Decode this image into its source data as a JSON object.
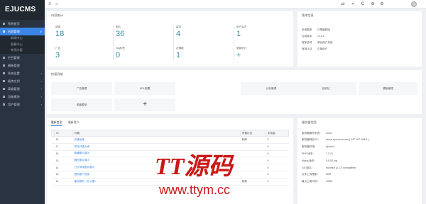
{
  "app": {
    "logo": "EJUCMS"
  },
  "sidebar": {
    "items": [
      {
        "label": "系统首页",
        "active": false,
        "sub": false,
        "chev": ""
      },
      {
        "label": "内容管理",
        "active": true,
        "sub": false,
        "chev": "∨"
      },
      {
        "label": "新闻中心",
        "active": false,
        "sub": true,
        "chev": ""
      },
      {
        "label": "图集中心",
        "active": false,
        "sub": true,
        "chev": ""
      },
      {
        "label": "单页内容",
        "active": false,
        "sub": true,
        "chev": ""
      },
      {
        "label": "栏目管理",
        "active": false,
        "sub": false,
        "chev": ""
      },
      {
        "label": "模板管理",
        "active": false,
        "sub": false,
        "chev": ""
      },
      {
        "label": "系统设置",
        "active": false,
        "sub": false,
        "chev": "›"
      },
      {
        "label": "插件应用",
        "active": false,
        "sub": false,
        "chev": "›"
      },
      {
        "label": "高级管理",
        "active": false,
        "sub": false,
        "chev": "›"
      },
      {
        "label": "功能模块",
        "active": false,
        "sub": false,
        "chev": "›"
      },
      {
        "label": "用户管理",
        "active": false,
        "sub": false,
        "chev": "›"
      }
    ]
  },
  "topbar": {
    "left_icons": [
      "≡",
      "⌂"
    ],
    "right_icons": [
      "⇄",
      "»",
      "C",
      "⊕",
      "⚙"
    ]
  },
  "stats": {
    "title": "内容统计",
    "items": [
      {
        "label": "新闻",
        "value": "18"
      },
      {
        "label": "图片",
        "value": "36"
      },
      {
        "label": "留言",
        "value": "4"
      },
      {
        "label": "用户会员",
        "value": "1"
      },
      {
        "label": "广告",
        "value": "3"
      },
      {
        "label": "Tag标签",
        "value": "0"
      },
      {
        "label": "友情链",
        "value": "1"
      },
      {
        "label": "更新统计",
        "value": "+"
      }
    ]
  },
  "version": {
    "title": "版本信息",
    "rows": [
      {
        "k": "系统更新",
        "v": "已是最新版"
      },
      {
        "k": "当前版本",
        "v": "v1.0.0"
      },
      {
        "k": "程序名称",
        "v": "易优用户系统"
      },
      {
        "k": "官网认证",
        "v": "正版用户"
      }
    ]
  },
  "quick": {
    "title": "快速导航",
    "items": [
      "广告管理",
      "URL配置",
      "",
      "分析管理",
      "回收站",
      "模板管理",
      "频道模型",
      "+"
    ]
  },
  "articles": {
    "tabs": [
      "最新信息",
      "最新用户"
    ],
    "headers": [
      "",
      "ID",
      "标题",
      "所属栏目",
      "浏览量"
    ],
    "rows": [
      {
        "id": "18",
        "title": "告通出席",
        "col": "新闻",
        "views": "0"
      },
      {
        "id": "17",
        "title": "项目开建大考",
        "col": "",
        "views": "0"
      },
      {
        "id": "16",
        "title": "精编图片展示",
        "col": "",
        "views": "0"
      },
      {
        "id": "15",
        "title": "圆形图片展示",
        "col": "",
        "views": "0"
      },
      {
        "id": "14",
        "title": "万分排序图片展示",
        "col": "",
        "views": "0"
      },
      {
        "id": "13",
        "title": "团队客户信息",
        "col": "",
        "views": "0"
      },
      {
        "id": "12",
        "title": "重点服务（办公楼）",
        "col": "新闻",
        "views": "0"
      }
    ]
  },
  "server": {
    "title": "服务器信息",
    "rows": [
      {
        "k": "服务器操作系统：",
        "v": "Linux"
      },
      {
        "k": "服务器域名/IP：",
        "v": "demo.eyoucms.com [ 147.107.165.8 ]"
      },
      {
        "k": "服务器环境：",
        "v": "Apache"
      },
      {
        "k": "PHP 版本：",
        "v": "7.2.21"
      },
      {
        "k": "Mysql 版本：",
        "v": "5.5.52-log"
      },
      {
        "k": "GD 版本：",
        "v": "bundled (2.1.0 compatible)"
      },
      {
        "k": "文件上传限制：",
        "v": "50M"
      },
      {
        "k": "最大占用内存：",
        "v": "128M"
      }
    ]
  },
  "watermark": {
    "line1": "TT源码",
    "line2": "www.ttym.cc"
  }
}
